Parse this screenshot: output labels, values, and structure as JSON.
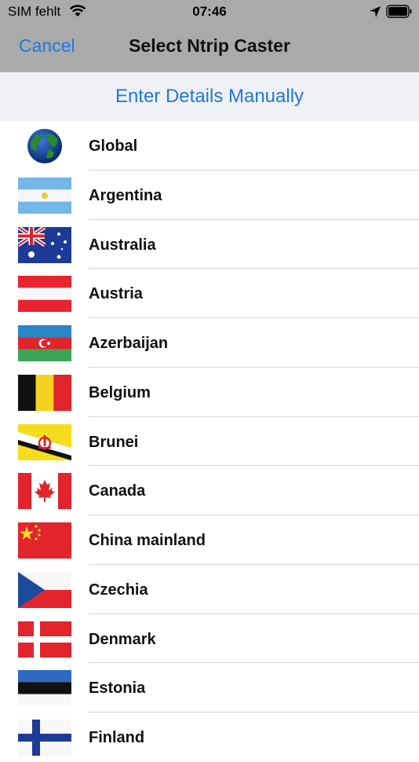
{
  "status": {
    "carrier": "SIM fehlt",
    "time": "07:46"
  },
  "nav": {
    "cancel": "Cancel",
    "title": "Select Ntrip Caster"
  },
  "manual_label": "Enter Details Manually",
  "countries": [
    {
      "name": "Global",
      "flag": "globe-icon"
    },
    {
      "name": "Argentina",
      "flag": "argentina-flag-icon"
    },
    {
      "name": "Australia",
      "flag": "australia-flag-icon"
    },
    {
      "name": "Austria",
      "flag": "austria-flag-icon"
    },
    {
      "name": "Azerbaijan",
      "flag": "azerbaijan-flag-icon"
    },
    {
      "name": "Belgium",
      "flag": "belgium-flag-icon"
    },
    {
      "name": "Brunei",
      "flag": "brunei-flag-icon"
    },
    {
      "name": "Canada",
      "flag": "canada-flag-icon"
    },
    {
      "name": "China mainland",
      "flag": "china-flag-icon"
    },
    {
      "name": "Czechia",
      "flag": "czechia-flag-icon"
    },
    {
      "name": "Denmark",
      "flag": "denmark-flag-icon"
    },
    {
      "name": "Estonia",
      "flag": "estonia-flag-icon"
    },
    {
      "name": "Finland",
      "flag": "finland-flag-icon"
    }
  ],
  "colors": {
    "accent": "#1f78e0",
    "header": "#aaaaaa",
    "manual_bg": "#f0f1f5"
  }
}
